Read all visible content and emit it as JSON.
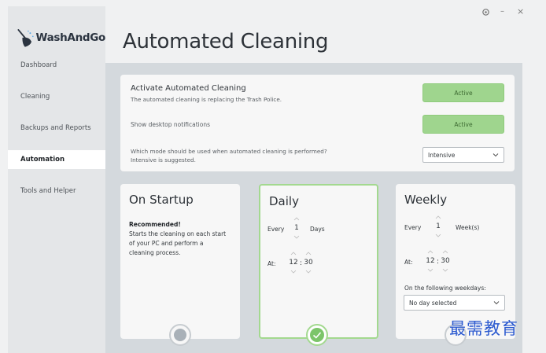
{
  "app": {
    "brand": "WashAndGo"
  },
  "window": {
    "settings_icon": "gear-icon",
    "minimize": "–",
    "close": "×"
  },
  "sidebar": {
    "items": [
      {
        "label": "Dashboard"
      },
      {
        "label": "Cleaning"
      },
      {
        "label": "Backups and Reports"
      },
      {
        "label": "Automation",
        "active": true
      },
      {
        "label": "Tools and Helper"
      }
    ]
  },
  "page": {
    "title": "Automated Cleaning"
  },
  "settings": {
    "activate": {
      "title": "Activate Automated Cleaning",
      "subtitle": "The automated cleaning is replacing the Trash Police.",
      "button": "Active"
    },
    "notifications": {
      "label": "Show desktop notifications",
      "button": "Active"
    },
    "mode": {
      "question_line1": "Which mode should be used when automated cleaning is performed?",
      "question_line2": "Intensive is suggested.",
      "selected": "Intensive"
    }
  },
  "modes": {
    "startup": {
      "title": "On Startup",
      "recommended": "Recommended!",
      "desc": [
        "Starts the cleaning on each start",
        "of your PC and perform a",
        "cleaning process."
      ]
    },
    "daily": {
      "title": "Daily",
      "every_label": "Every",
      "every_value": "1",
      "unit": "Days",
      "at_label": "At:",
      "hour": "12",
      "sep": ":",
      "minute": "30",
      "selected": true
    },
    "weekly": {
      "title": "Weekly",
      "every_label": "Every",
      "every_value": "1",
      "unit": "Week(s)",
      "at_label": "At:",
      "hour": "12",
      "sep": ":",
      "minute": "30",
      "weekdays_label": "On the following weekdays:",
      "weekdays_selected": "No day selected"
    }
  },
  "colors": {
    "accent": "#9fd58e",
    "accent_border": "#a3d98f",
    "check": "#7cc56a"
  },
  "watermark": "最需教育"
}
